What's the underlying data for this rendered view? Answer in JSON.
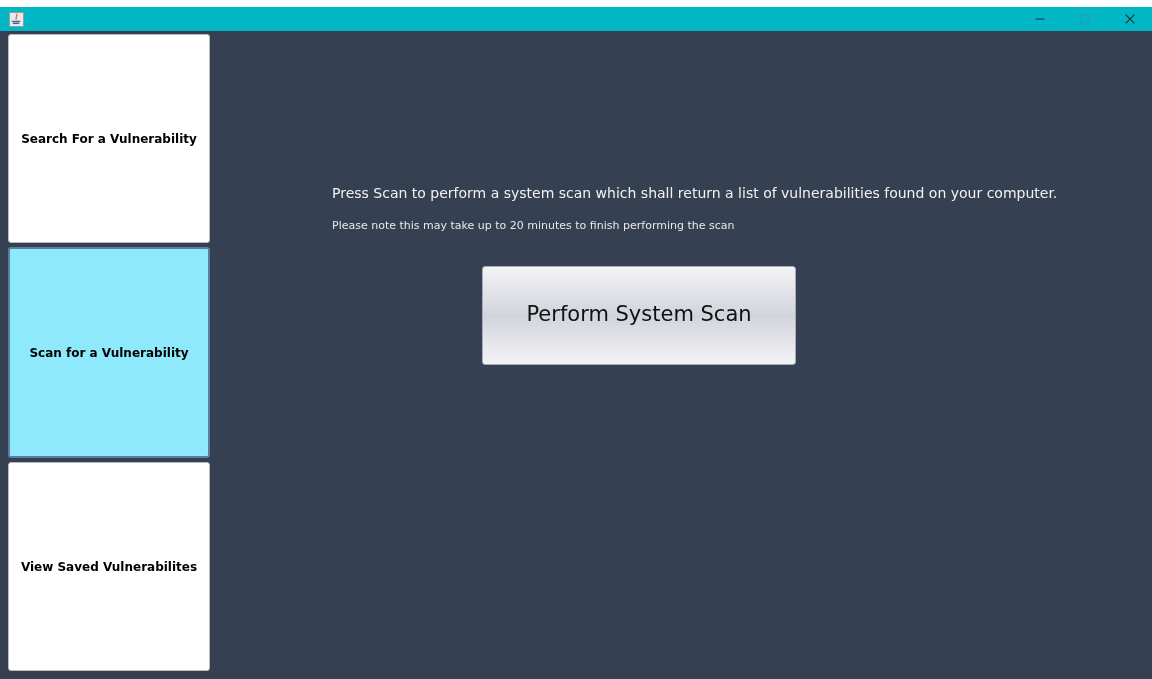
{
  "window": {
    "controls": [
      {
        "kind": "minimize"
      },
      {
        "kind": "maximize",
        "disabled": true
      },
      {
        "kind": "close"
      }
    ]
  },
  "sidebar": {
    "items": [
      {
        "label": "Search For a Vulnerability",
        "selected": false
      },
      {
        "label": "Scan for a Vulnerability",
        "selected": true
      },
      {
        "label": "View Saved Vulnerabilites",
        "selected": false
      }
    ]
  },
  "main": {
    "message": "Press Scan to perform a system scan which shall return a list of vulnerabilities found on your computer.",
    "note": "Please note this may take up to 20 minutes to finish performing the scan",
    "button": "Perform System Scan"
  }
}
